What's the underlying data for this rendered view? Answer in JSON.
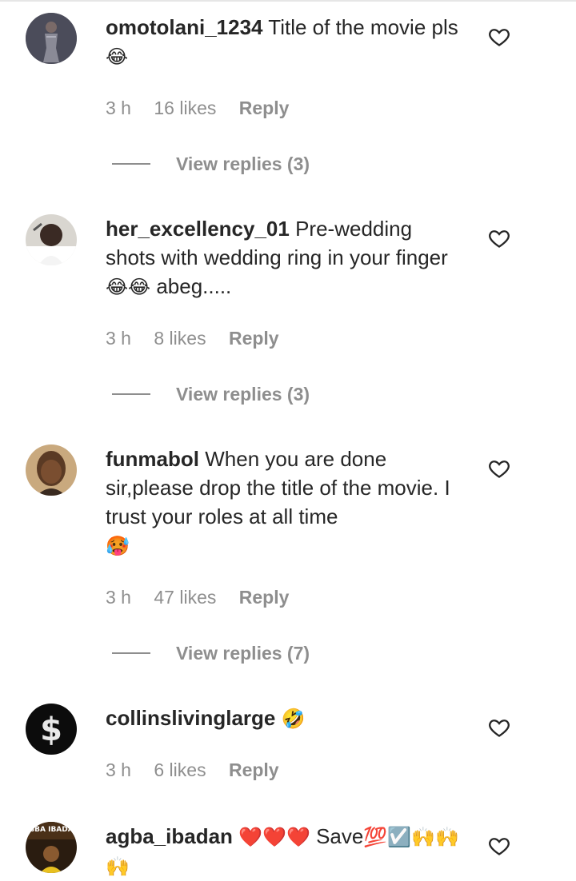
{
  "comments": [
    {
      "username": "omotolani_1234",
      "text": "Title of the movie pls",
      "emoji": "😂",
      "time": "3 h",
      "likes": "16 likes",
      "reply": "Reply",
      "view_replies": "View replies (3)"
    },
    {
      "username": "her_excellency_01",
      "text": "Pre-wedding shots with wedding ring in your finger",
      "emoji": "😂😂",
      "text_after": " abeg.....",
      "time": "3 h",
      "likes": "8 likes",
      "reply": "Reply",
      "view_replies": "View replies (3)"
    },
    {
      "username": "funmabol",
      "text": "When you are done sir,please drop the title of the movie. I trust your roles at all time",
      "emoji": "🥵",
      "time": "3 h",
      "likes": "47 likes",
      "reply": "Reply",
      "view_replies": "View replies (7)"
    },
    {
      "username": "collinslivinglarge",
      "text": "",
      "emoji": "🤣",
      "time": "3 h",
      "likes": "6 likes",
      "reply": "Reply"
    },
    {
      "username": "agba_ibadan",
      "emoji_lead": "❤️❤️❤️",
      "text": "Save",
      "emoji": "💯☑️🙌🙌🙌"
    }
  ],
  "avatar_badge_text": "AGBA IBADAN"
}
